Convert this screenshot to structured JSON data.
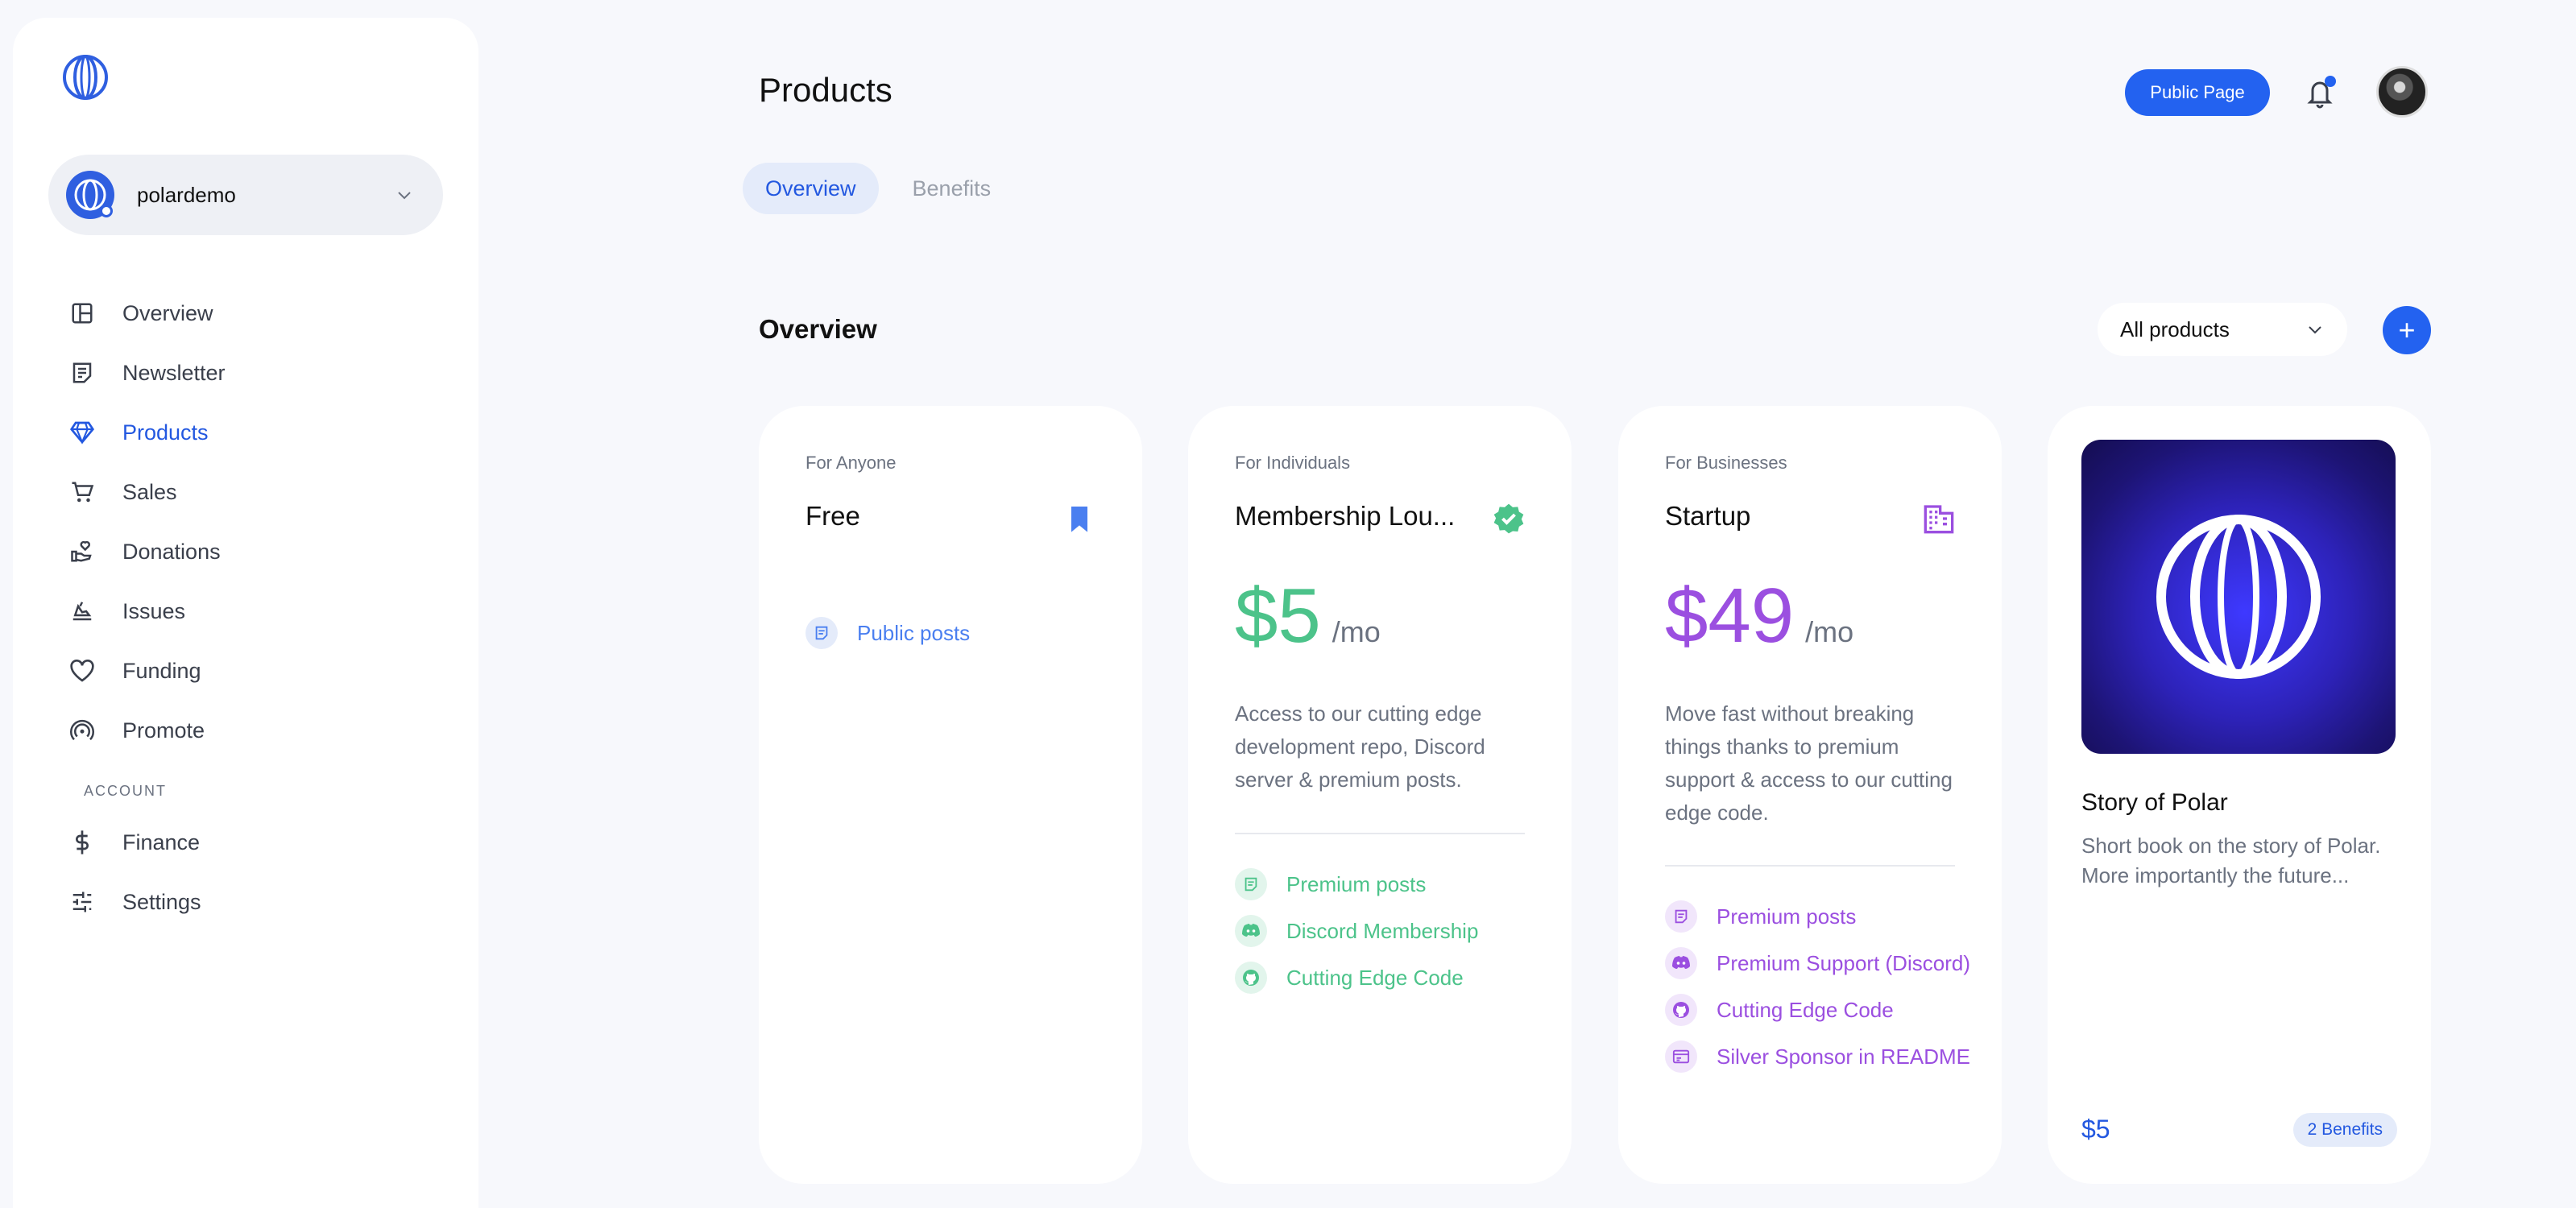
{
  "sidebar": {
    "org_name": "polardemo",
    "nav": [
      {
        "label": "Overview",
        "icon": "layout-icon"
      },
      {
        "label": "Newsletter",
        "icon": "newsletter-icon"
      },
      {
        "label": "Products",
        "icon": "diamond-icon",
        "active": true
      },
      {
        "label": "Sales",
        "icon": "cart-icon"
      },
      {
        "label": "Donations",
        "icon": "donation-icon"
      },
      {
        "label": "Issues",
        "icon": "issue-icon"
      },
      {
        "label": "Funding",
        "icon": "heart-icon"
      },
      {
        "label": "Promote",
        "icon": "broadcast-icon"
      }
    ],
    "account_section": "ACCOUNT",
    "account_nav": [
      {
        "label": "Finance",
        "icon": "dollar-icon"
      },
      {
        "label": "Settings",
        "icon": "sliders-icon"
      }
    ]
  },
  "header": {
    "title": "Products",
    "public_page_label": "Public Page"
  },
  "tabs": [
    {
      "label": "Overview",
      "active": true
    },
    {
      "label": "Benefits"
    }
  ],
  "main": {
    "section_title": "Overview",
    "filter_value": "All products",
    "add_label": "+"
  },
  "cards": [
    {
      "audience": "For Anyone",
      "name": "Free",
      "icon": "bookmark-icon",
      "color": "#4a7ff0",
      "benefits": [
        {
          "label": "Public posts",
          "icon": "post-icon"
        }
      ]
    },
    {
      "audience": "For Individuals",
      "name": "Membership Lou...",
      "icon": "verified-icon",
      "color": "#4cc38a",
      "price": "$5",
      "period": "/mo",
      "description": "Access to our cutting edge development repo, Discord server & premium posts.",
      "benefits": [
        {
          "label": "Premium posts",
          "icon": "post-icon"
        },
        {
          "label": "Discord Membership",
          "icon": "discord-icon"
        },
        {
          "label": "Cutting Edge Code",
          "icon": "github-icon"
        }
      ]
    },
    {
      "audience": "For Businesses",
      "name": "Startup",
      "icon": "building-icon",
      "color": "#9b4fe0",
      "price": "$49",
      "period": "/mo",
      "description": "Move fast without breaking things thanks to premium support & access to our cutting edge code.",
      "benefits": [
        {
          "label": "Premium posts",
          "icon": "post-icon"
        },
        {
          "label": "Premium Support (Discord)",
          "icon": "discord-icon"
        },
        {
          "label": "Cutting Edge Code",
          "icon": "github-icon"
        },
        {
          "label": "Silver Sponsor in README",
          "icon": "ad-icon"
        }
      ]
    }
  ],
  "book": {
    "title": "Story of Polar",
    "description": "Short book on the story of Polar. More importantly the future...",
    "price": "$5",
    "benefits_badge": "2 Benefits"
  }
}
